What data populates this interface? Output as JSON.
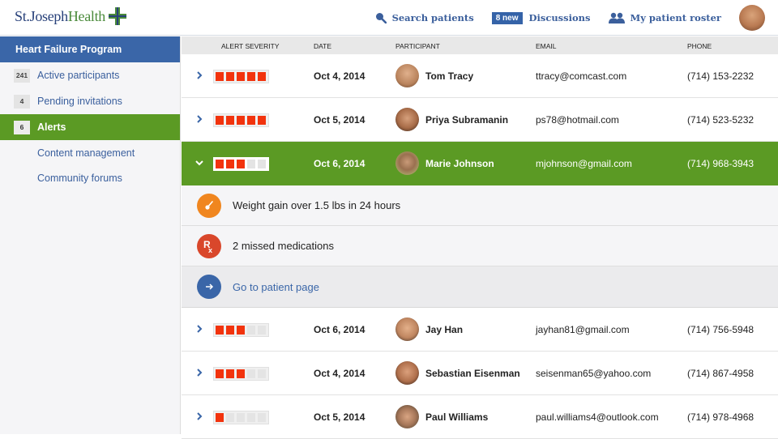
{
  "header": {
    "logo_st": "St.Joseph",
    "logo_health": "Health",
    "nav": {
      "search_label": "Search patients",
      "discussions_badge": "8 new",
      "discussions_label": "Discussions",
      "roster_label": "My patient roster"
    }
  },
  "sidebar": {
    "title": "Heart Failure Program",
    "items": [
      {
        "count": "241",
        "label": "Active participants"
      },
      {
        "count": "4",
        "label": "Pending invitations"
      },
      {
        "count": "6",
        "label": "Alerts",
        "active": true
      },
      {
        "label": "Content management"
      },
      {
        "label": "Community forums"
      }
    ]
  },
  "table": {
    "columns": [
      "ALERT SEVERITY",
      "DATE",
      "PARTICIPANT",
      "EMAIL",
      "PHONE"
    ],
    "severity_max": 5,
    "rows": [
      {
        "severity": 5,
        "date": "Oct 4, 2014",
        "name": "Tom Tracy",
        "email": "ttracy@comcast.com",
        "phone": "(714) 153-2232"
      },
      {
        "severity": 5,
        "date": "Oct 5, 2014",
        "name": "Priya Subramanin",
        "email": "ps78@hotmail.com",
        "phone": "(714) 523-5232"
      },
      {
        "severity": 3,
        "date": "Oct 6, 2014",
        "name": "Marie Johnson",
        "email": "mjohnson@gmail.com",
        "phone": "(714) 968-3943",
        "expanded": true
      },
      {
        "severity": 3,
        "date": "Oct 6, 2014",
        "name": "Jay Han",
        "email": "jayhan81@gmail.com",
        "phone": "(714) 756-5948"
      },
      {
        "severity": 3,
        "date": "Oct 4, 2014",
        "name": "Sebastian Eisenman",
        "email": "seisenman65@yahoo.com",
        "phone": "(714) 867-4958"
      },
      {
        "severity": 1,
        "date": "Oct 5, 2014",
        "name": "Paul Williams",
        "email": "paul.williams4@outlook.com",
        "phone": "(714) 978-4968"
      }
    ],
    "expanded_details": {
      "alerts": [
        {
          "icon": "scale-gauge-icon",
          "text": "Weight gain over 1.5 lbs in 24 hours"
        },
        {
          "icon": "rx-icon",
          "text": "2 missed medications"
        }
      ],
      "goto_label": "Go to patient page"
    }
  },
  "colors": {
    "brand_blue": "#3a66a8",
    "active_green": "#5b9a24",
    "severity_red": "#f2330d",
    "weight_orange": "#f0861f",
    "rx_red": "#d9472b"
  }
}
